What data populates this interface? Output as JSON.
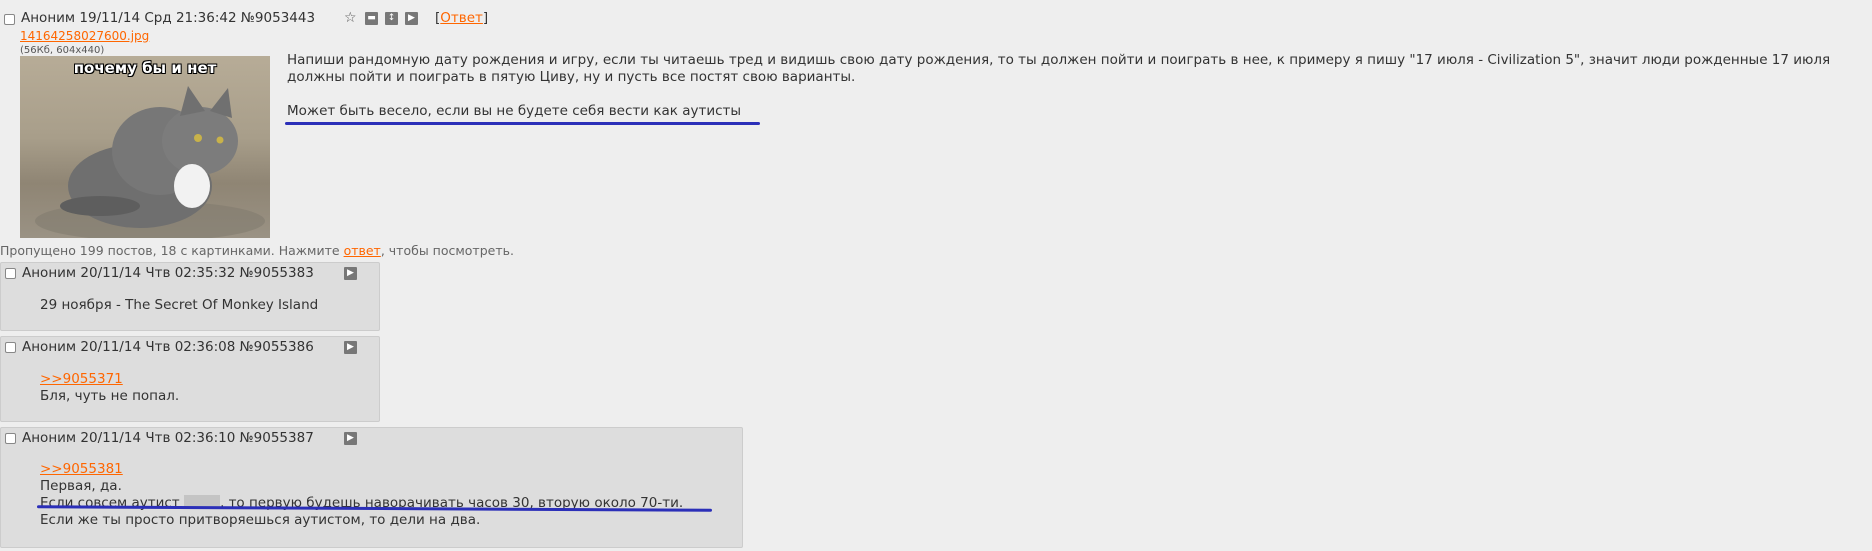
{
  "op": {
    "author": "Аноним",
    "date": "19/11/14 Срд 21:36:42",
    "number": "№9053443",
    "reply_label": "Ответ",
    "file_name": "14164258027600.jpg",
    "file_meta": "(56Кб, 604x440)",
    "image_caption": "почему бы и нет",
    "text_p1": "Напиши рандомную дату рождения и игру, если ты читаешь тред и видишь свою дату рождения, то ты должен пойти и поиграть в нее, к примеру я пишу \"17 июля - Civilization 5\", значит люди рожденные 17 июля должны пойти и поиграть в пятую Циву, ну и пусть все постят свою варианты.",
    "text_p2": "Может быть весело, если вы не будете себя вести как аутисты"
  },
  "omitted": {
    "before": "Пропущено 199 постов, 18 с картинками. Нажмите ",
    "link": "ответ",
    "after": ", чтобы посмотреть."
  },
  "posts": [
    {
      "author": "Аноним",
      "date": "20/11/14 Чтв 02:35:32",
      "number": "№9055383",
      "lines": [
        "29 ноября - The Secret Of Monkey Island"
      ]
    },
    {
      "author": "Аноним",
      "date": "20/11/14 Чтв 02:36:08",
      "number": "№9055386",
      "quote": ">>9055371",
      "lines": [
        "Бля, чуть не попал."
      ]
    },
    {
      "author": "Аноним",
      "date": "20/11/14 Чтв 02:36:10",
      "number": "№9055387",
      "quote": ">>9055381",
      "lines": [
        "Первая, да.",
        "Если совсем аутист",
        ", то первую будешь наворачивать часов 30, вторую около 70-ти.",
        "Если же ты просто притворяешься аутистом, то дели на два."
      ]
    }
  ],
  "colors": {
    "background": "#eeeeee",
    "post_background": "#dddddd",
    "link": "#ff6600",
    "annotation_underline": "#2b2fb8"
  },
  "icons": [
    "checkbox",
    "star-icon",
    "hide-icon",
    "expand-icon",
    "play-icon"
  ]
}
